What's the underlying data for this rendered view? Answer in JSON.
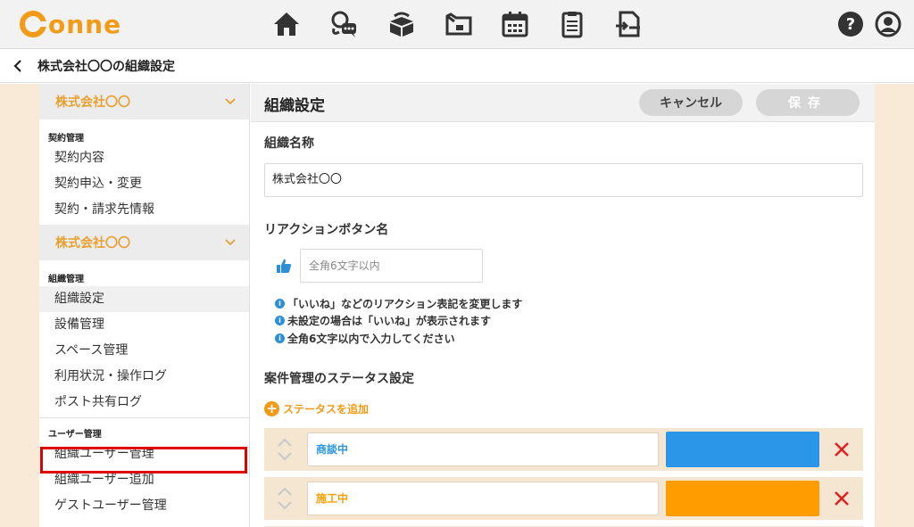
{
  "app": {
    "logo_text": "onne"
  },
  "nav": {
    "items": [
      {
        "icon": "home-icon"
      },
      {
        "icon": "chat-icon"
      },
      {
        "icon": "handshake-box-icon"
      },
      {
        "icon": "folder-icon"
      },
      {
        "icon": "calendar-icon"
      },
      {
        "icon": "clipboard-icon"
      },
      {
        "icon": "document-share-icon"
      }
    ],
    "help_icon": "help-icon",
    "user_icon": "user-icon"
  },
  "breadcrumb": {
    "title": "株式会社〇〇の組織設定"
  },
  "sidebar": {
    "org_header_1": "株式会社〇〇",
    "group_contract": "契約管理",
    "contract_items": [
      "契約内容",
      "契約申込・変更",
      "契約・請求先情報"
    ],
    "org_header_2": "株式会社〇〇",
    "group_org": "組織管理",
    "org_items": [
      "組織設定",
      "設備管理",
      "スペース管理",
      "利用状況・操作ログ",
      "ポスト共有ログ"
    ],
    "group_user": "ユーザー管理",
    "user_items": [
      "組織ユーザー管理",
      "組織ユーザー追加",
      "ゲストユーザー管理"
    ]
  },
  "main": {
    "title": "組織設定",
    "cancel_label": "キャンセル",
    "save_label": "保存",
    "org_name_label": "組織名称",
    "org_name_value": "株式会社〇〇",
    "reaction_label": "リアクションボタン名",
    "reaction_placeholder": "全角6文字以内",
    "info": [
      "「いいね」などのリアクション表記を変更します",
      "未設定の場合は「いいね」が表示されます",
      "全角6文字以内で入力してください"
    ],
    "status_section_label": "案件管理のステータス設定",
    "add_status_label": "ステータスを追加",
    "statuses": [
      {
        "name": "商談中",
        "color": "#2b96e8",
        "text_color": "#2b96e8"
      },
      {
        "name": "施工中",
        "color": "#ff9c00",
        "text_color": "#ff9c00"
      }
    ]
  },
  "colors": {
    "brand": "#f39a17",
    "highlight": "#e00000",
    "info": "#2d8fd9",
    "delete": "#e02020"
  }
}
